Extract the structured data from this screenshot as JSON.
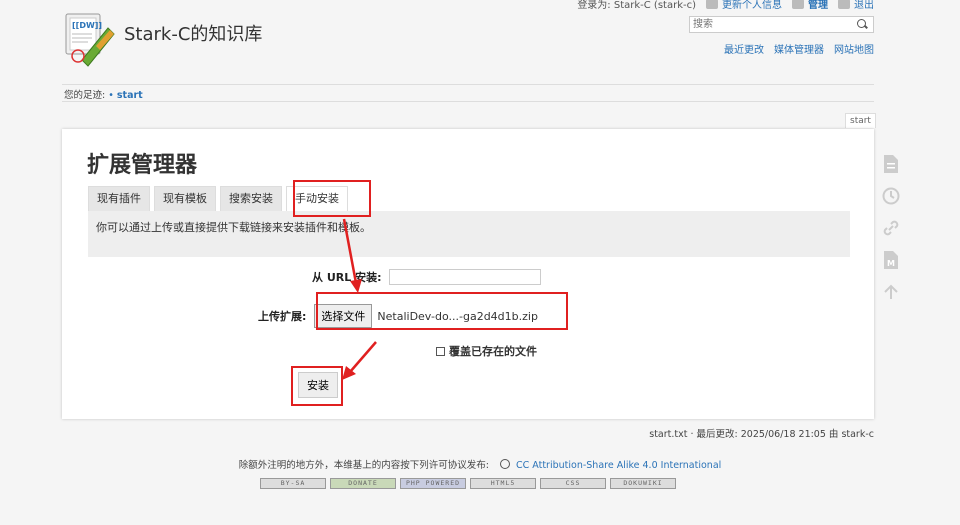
{
  "userbar": {
    "logged_in_as": "登录为: Stark-C (stark-c)",
    "update_profile": "更新个人信息",
    "admin": "管理",
    "logout": "退出"
  },
  "site": {
    "title": "Stark-C的知识库"
  },
  "search": {
    "placeholder": "搜索"
  },
  "toollinks": {
    "recent": "最近更改",
    "media": "媒体管理器",
    "sitemap": "网站地图"
  },
  "breadcrumb": {
    "label": "您的足迹:",
    "sep": "•",
    "current": "start"
  },
  "page_id": "start",
  "main": {
    "title": "扩展管理器",
    "tabs": [
      {
        "label": "现有插件"
      },
      {
        "label": "现有模板"
      },
      {
        "label": "搜索安装"
      },
      {
        "label": "手动安装"
      }
    ],
    "info": "你可以通过上传或直接提供下载链接来安装插件和模板。",
    "url_label": "从 URL 安装:",
    "upload_label": "上传扩展:",
    "file_button": "选择文件",
    "file_name": "NetaliDev-do...-ga2d4d1b.zip",
    "overwrite_label": "覆盖已存在的文件",
    "install_button": "安装"
  },
  "docinfo": "start.txt · 最后更改: 2025/06/18 21:05 由 stark-c",
  "license": {
    "text": "除额外注明的地方外，本维基上的内容按下列许可协议发布:",
    "link": "CC Attribution-Share Alike 4.0 International"
  },
  "badges": [
    "BY-SA",
    "DONATE",
    "PHP POWERED",
    "HTML5",
    "CSS",
    "DOKUWIKI"
  ],
  "colors": {
    "link": "#2b73b7",
    "annotation": "#e02020",
    "panel_bg": "#ffffff",
    "page_bg": "#f5f5f5"
  }
}
